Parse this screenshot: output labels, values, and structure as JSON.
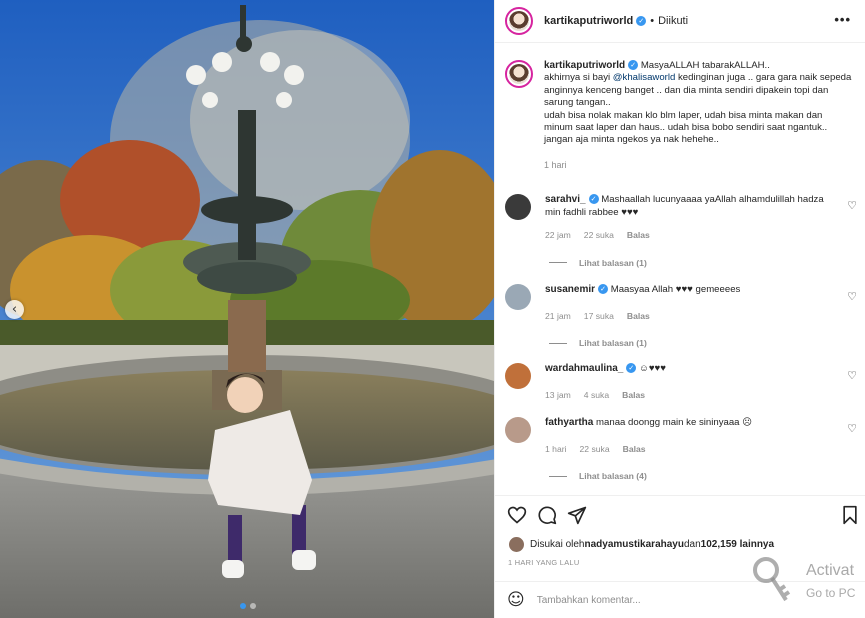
{
  "post": {
    "username": "kartikaputriworld",
    "verified_glyph": "✓",
    "separator": "•",
    "follow_status": "Diikuti",
    "more_glyph": "•••"
  },
  "caption": {
    "username": "kartikaputriworld",
    "line1": "MasyaALLAH tabarakALLAH..",
    "line2_pre": "akhirnya si bayi ",
    "mention": "@khalisaworld",
    "line2_post": " kedinginan juga .. gara gara naik sepeda anginnya kenceng banget .. dan dia minta sendiri dipakein topi dan sarung tangan..",
    "line3": "udah bisa nolak makan klo blm laper, udah bisa minta makan dan minum saat laper dan haus.. udah bisa bobo sendiri saat ngantuk.. jangan aja minta ngekos ya nak hehehe..",
    "age": "1 hari"
  },
  "comments": [
    {
      "username": "sarahvi_",
      "verified": true,
      "text": "Mashaallah lucunyaaaa yaAllah alhamdulillah hadza min fadhli rabbee ♥♥♥",
      "time": "22 jam",
      "likes": "22 suka",
      "reply": "Balas",
      "replies": "Lihat balasan (1)",
      "avatar_color": "#3a3a3a"
    },
    {
      "username": "susanemir",
      "verified": true,
      "text": "Maasyaa Allah ♥♥♥ gemeeees",
      "time": "21 jam",
      "likes": "17 suka",
      "reply": "Balas",
      "replies": "Lihat balasan (1)",
      "avatar_color": "#9aa8b5"
    },
    {
      "username": "wardahmaulina_",
      "verified": true,
      "text": "☺♥♥♥",
      "time": "13 jam",
      "likes": "4 suka",
      "reply": "Balas",
      "replies": "",
      "avatar_color": "#c0703a"
    },
    {
      "username": "fathyartha",
      "verified": false,
      "text": "manaa doongg main ke sininyaaa ☹",
      "time": "1 hari",
      "likes": "22 suka",
      "reply": "Balas",
      "replies": "Lihat balasan (4)",
      "avatar_color": "#b89a8a"
    }
  ],
  "likes": {
    "prefix": "Disukai oleh ",
    "user": "nadyamustikarahayu",
    "middle": " dan ",
    "count": "102,159 lainnya"
  },
  "timestamp": "1 HARI YANG LALU",
  "add_comment": {
    "placeholder": "Tambahkan komentar...",
    "emoji": "☺"
  },
  "photo": {
    "prev_glyph": "‹"
  },
  "watermark": {
    "line1": "Activat",
    "line2": "Go to PC"
  },
  "colors": {
    "accent": "#3897f0",
    "link": "#00376b",
    "muted": "#8e8e8e"
  },
  "icons": [
    "heart-icon",
    "comment-icon",
    "share-icon",
    "bookmark-icon",
    "emoji-icon",
    "more-icon",
    "chevron-left-icon",
    "verified-icon"
  ]
}
